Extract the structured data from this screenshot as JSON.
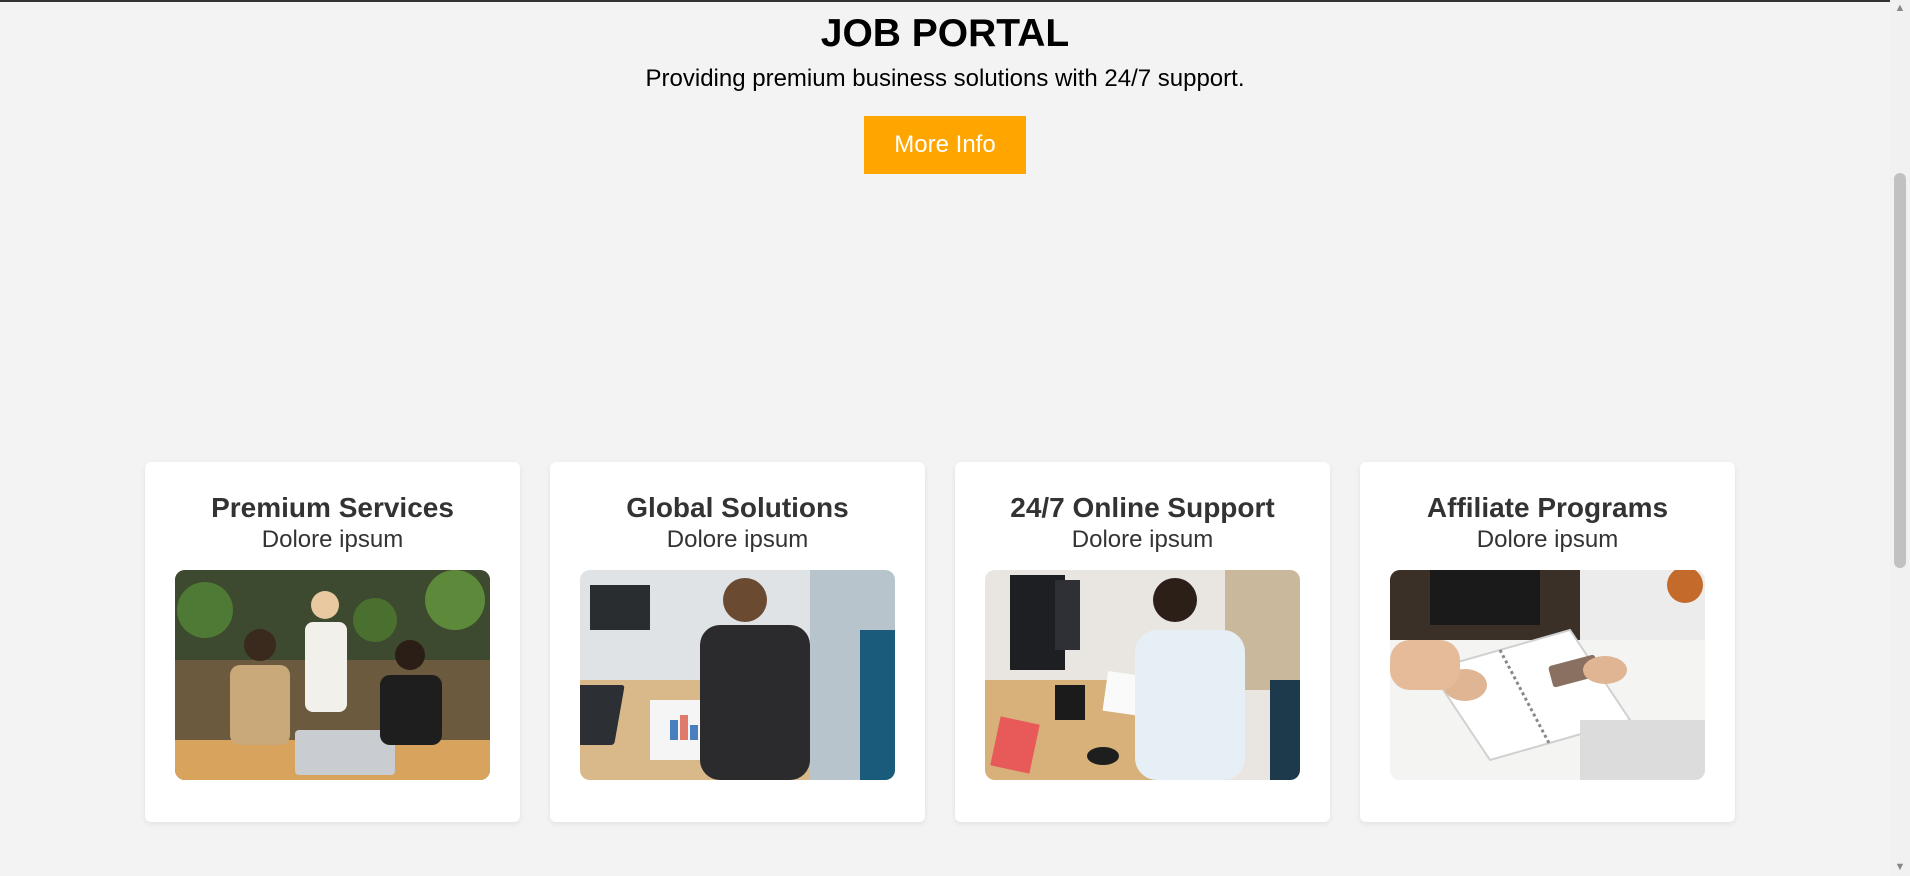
{
  "hero": {
    "title": "JOB PORTAL",
    "subtitle": "Providing premium business solutions with 24/7 support.",
    "button_label": "More Info"
  },
  "colors": {
    "accent": "#ffa500",
    "background": "#f3f3f3",
    "card": "#ffffff"
  },
  "cards": [
    {
      "title": "Premium Services",
      "subtitle": "Dolore ipsum",
      "image": "office-team-meeting-photo"
    },
    {
      "title": "Global Solutions",
      "subtitle": "Dolore ipsum",
      "image": "businessman-reviewing-charts-photo"
    },
    {
      "title": "24/7 Online Support",
      "subtitle": "Dolore ipsum",
      "image": "man-writing-at-desk-photo"
    },
    {
      "title": "Affiliate Programs",
      "subtitle": "Dolore ipsum",
      "image": "hands-notebook-phone-photo"
    }
  ],
  "scrollbar": {
    "up_icon": "scroll-up-arrow-icon",
    "down_icon": "scroll-down-arrow-icon"
  }
}
